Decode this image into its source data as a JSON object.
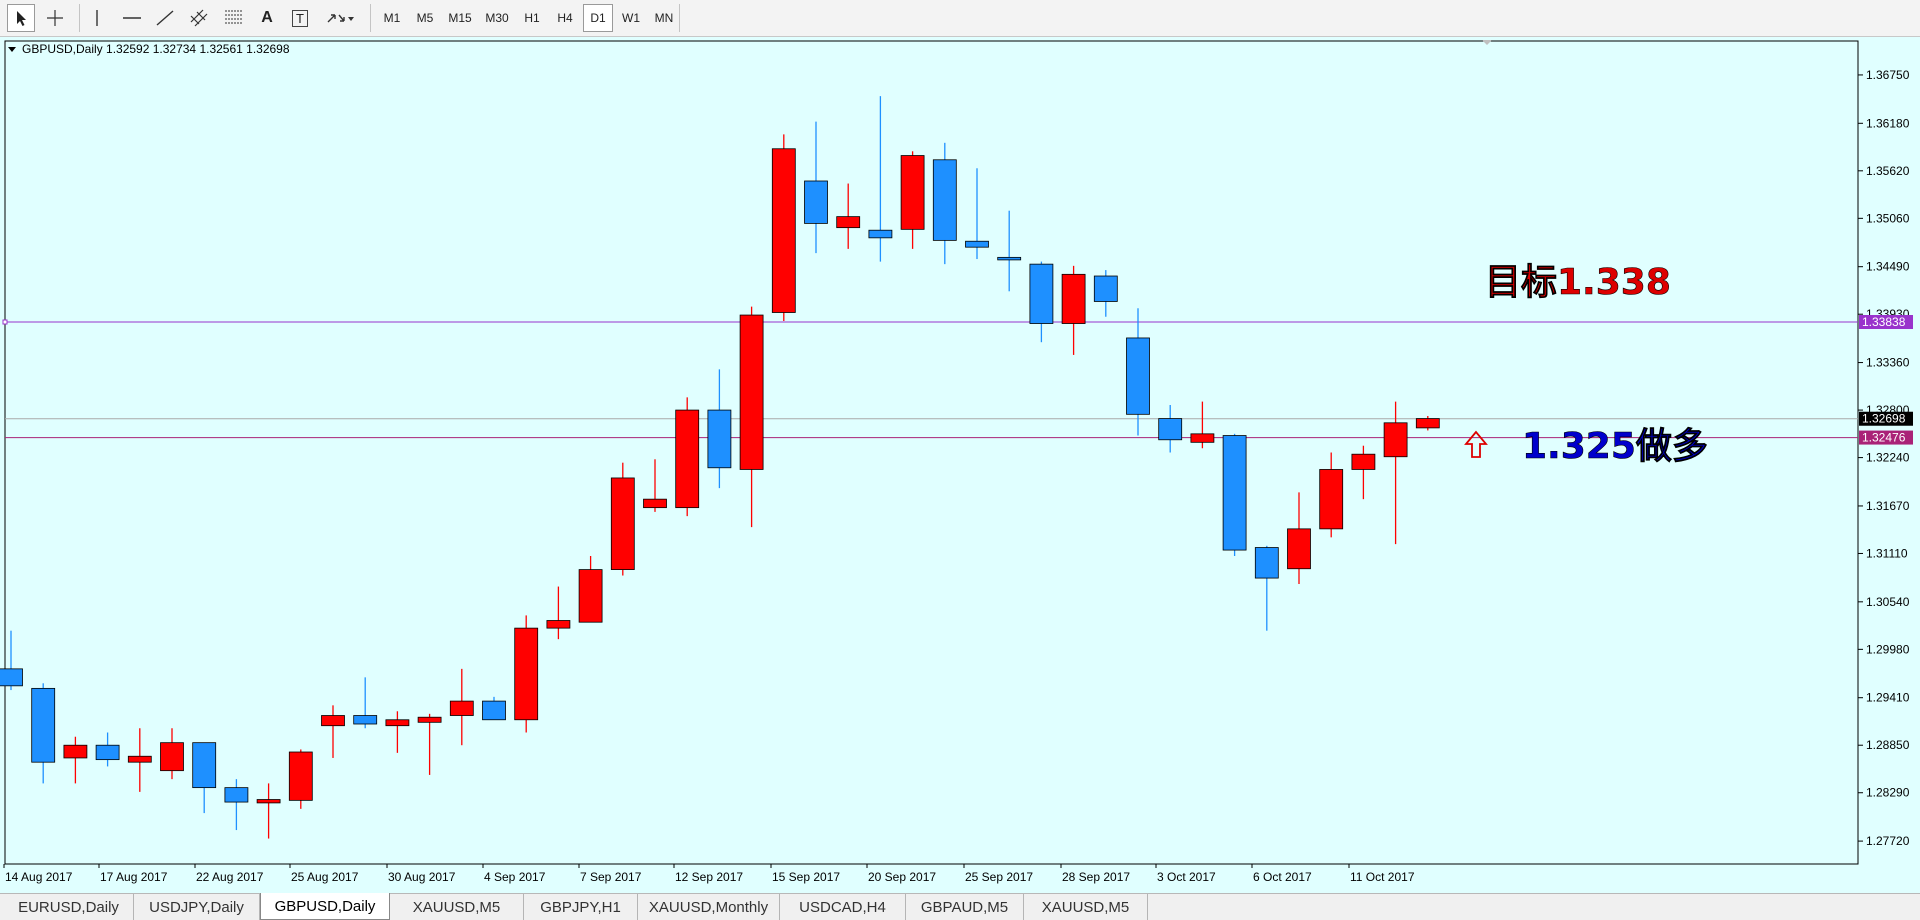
{
  "toolbar": {
    "tools": [
      {
        "name": "cursor-icon"
      },
      {
        "name": "crosshair-icon"
      },
      {
        "name": "vertical-line-icon"
      },
      {
        "name": "horizontal-line-icon"
      },
      {
        "name": "trendline-icon"
      },
      {
        "name": "equidistant-channel-icon"
      },
      {
        "name": "fibonacci-icon"
      },
      {
        "name": "text-icon"
      },
      {
        "name": "text-label-icon"
      },
      {
        "name": "arrows-icon"
      }
    ],
    "text_tool_label": "A",
    "text_label_tool_label": "T",
    "timeframes": [
      "M1",
      "M5",
      "M15",
      "M30",
      "H1",
      "H4",
      "D1",
      "W1",
      "MN"
    ],
    "active_timeframe": "D1"
  },
  "chart": {
    "header": "GBPUSD,Daily  1.32592 1.32734 1.32561 1.32698",
    "bg_color": "#e0ffff",
    "bull_color": "#ff0000",
    "bear_color": "#1e90ff",
    "annotations": {
      "target_text": "目标1.338",
      "entry_text": "1.325做多",
      "target_color": "#dd0000",
      "entry_color": "#0000cc"
    }
  },
  "chart_data": {
    "type": "candlestick",
    "symbol": "GBPUSD",
    "timeframe": "Daily",
    "ylim": [
      1.2745,
      1.3715
    ],
    "y_ticks": [
      "1.36750",
      "1.36180",
      "1.35620",
      "1.35060",
      "1.34490",
      "1.33930",
      "1.33360",
      "1.32800",
      "1.32240",
      "1.31670",
      "1.31110",
      "1.30540",
      "1.29980",
      "1.29410",
      "1.28850",
      "1.28290",
      "1.27720"
    ],
    "x_labels": [
      "14 Aug 2017",
      "17 Aug 2017",
      "22 Aug 2017",
      "25 Aug 2017",
      "30 Aug 2017",
      "4 Sep 2017",
      "7 Sep 2017",
      "12 Sep 2017",
      "15 Sep 2017",
      "20 Sep 2017",
      "25 Sep 2017",
      "28 Sep 2017",
      "3 Oct 2017",
      "6 Oct 2017",
      "11 Oct 2017"
    ],
    "candles": [
      {
        "o": 1.2975,
        "h": 1.302,
        "l": 1.295,
        "c": 1.2955
      },
      {
        "o": 1.2952,
        "h": 1.2958,
        "l": 1.284,
        "c": 1.2865
      },
      {
        "o": 1.287,
        "h": 1.2895,
        "l": 1.284,
        "c": 1.2885
      },
      {
        "o": 1.2885,
        "h": 1.29,
        "l": 1.286,
        "c": 1.2868
      },
      {
        "o": 1.2865,
        "h": 1.2905,
        "l": 1.283,
        "c": 1.2872
      },
      {
        "o": 1.2855,
        "h": 1.2905,
        "l": 1.2845,
        "c": 1.2888
      },
      {
        "o": 1.2888,
        "h": 1.2888,
        "l": 1.2805,
        "c": 1.2835
      },
      {
        "o": 1.2835,
        "h": 1.2845,
        "l": 1.2785,
        "c": 1.2818
      },
      {
        "o": 1.2817,
        "h": 1.284,
        "l": 1.2775,
        "c": 1.2821
      },
      {
        "o": 1.282,
        "h": 1.288,
        "l": 1.281,
        "c": 1.2877
      },
      {
        "o": 1.2908,
        "h": 1.2932,
        "l": 1.287,
        "c": 1.292
      },
      {
        "o": 1.292,
        "h": 1.2965,
        "l": 1.2905,
        "c": 1.291
      },
      {
        "o": 1.2908,
        "h": 1.2925,
        "l": 1.2876,
        "c": 1.2915
      },
      {
        "o": 1.2912,
        "h": 1.2922,
        "l": 1.285,
        "c": 1.2918
      },
      {
        "o": 1.292,
        "h": 1.2975,
        "l": 1.2885,
        "c": 1.2937
      },
      {
        "o": 1.2937,
        "h": 1.2942,
        "l": 1.2915,
        "c": 1.2915
      },
      {
        "o": 1.2915,
        "h": 1.3038,
        "l": 1.29,
        "c": 1.3023
      },
      {
        "o": 1.3023,
        "h": 1.3072,
        "l": 1.301,
        "c": 1.3032
      },
      {
        "o": 1.303,
        "h": 1.3108,
        "l": 1.303,
        "c": 1.3092
      },
      {
        "o": 1.3092,
        "h": 1.3218,
        "l": 1.3085,
        "c": 1.32
      },
      {
        "o": 1.3165,
        "h": 1.3222,
        "l": 1.316,
        "c": 1.3175
      },
      {
        "o": 1.3165,
        "h": 1.3295,
        "l": 1.3155,
        "c": 1.328
      },
      {
        "o": 1.328,
        "h": 1.3328,
        "l": 1.3188,
        "c": 1.3212
      },
      {
        "o": 1.321,
        "h": 1.3402,
        "l": 1.3142,
        "c": 1.3392
      },
      {
        "o": 1.3395,
        "h": 1.3605,
        "l": 1.3385,
        "c": 1.3588
      },
      {
        "o": 1.355,
        "h": 1.362,
        "l": 1.3465,
        "c": 1.35
      },
      {
        "o": 1.3495,
        "h": 1.3547,
        "l": 1.347,
        "c": 1.3508
      },
      {
        "o": 1.3492,
        "h": 1.365,
        "l": 1.3455,
        "c": 1.3483
      },
      {
        "o": 1.3493,
        "h": 1.3585,
        "l": 1.347,
        "c": 1.358
      },
      {
        "o": 1.3575,
        "h": 1.3595,
        "l": 1.3452,
        "c": 1.348
      },
      {
        "o": 1.3479,
        "h": 1.3565,
        "l": 1.3458,
        "c": 1.3472
      },
      {
        "o": 1.346,
        "h": 1.3515,
        "l": 1.342,
        "c": 1.3457
      },
      {
        "o": 1.3452,
        "h": 1.3455,
        "l": 1.336,
        "c": 1.3382
      },
      {
        "o": 1.3382,
        "h": 1.345,
        "l": 1.3345,
        "c": 1.344
      },
      {
        "o": 1.3438,
        "h": 1.3445,
        "l": 1.339,
        "c": 1.3408
      },
      {
        "o": 1.3365,
        "h": 1.34,
        "l": 1.325,
        "c": 1.3275
      },
      {
        "o": 1.327,
        "h": 1.3286,
        "l": 1.323,
        "c": 1.3245
      },
      {
        "o": 1.3242,
        "h": 1.329,
        "l": 1.3235,
        "c": 1.3252
      },
      {
        "o": 1.325,
        "h": 1.3252,
        "l": 1.3108,
        "c": 1.3115
      },
      {
        "o": 1.3118,
        "h": 1.312,
        "l": 1.302,
        "c": 1.3082
      },
      {
        "o": 1.3093,
        "h": 1.3183,
        "l": 1.3075,
        "c": 1.314
      },
      {
        "o": 1.314,
        "h": 1.323,
        "l": 1.313,
        "c": 1.321
      },
      {
        "o": 1.321,
        "h": 1.3238,
        "l": 1.3175,
        "c": 1.3228
      },
      {
        "o": 1.3225,
        "h": 1.329,
        "l": 1.3122,
        "c": 1.3265
      },
      {
        "o": 1.3259,
        "h": 1.3273,
        "l": 1.3256,
        "c": 1.327
      }
    ],
    "hlines": [
      {
        "value": 1.33838,
        "label": "1.33838",
        "color": "#9933cc"
      },
      {
        "value": 1.32476,
        "label": "1.32476",
        "color": "#aa2277"
      }
    ],
    "bid_line": {
      "value": 1.32698,
      "label": "1.32698"
    }
  },
  "tabs": [
    {
      "label": "EURUSD,Daily"
    },
    {
      "label": "USDJPY,Daily"
    },
    {
      "label": "GBPUSD,Daily",
      "active": true
    },
    {
      "label": "XAUUSD,M5"
    },
    {
      "label": "GBPJPY,H1"
    },
    {
      "label": "XAUUSD,Monthly"
    },
    {
      "label": "USDCAD,H4"
    },
    {
      "label": "GBPAUD,M5"
    },
    {
      "label": "XAUUSD,M5"
    }
  ]
}
